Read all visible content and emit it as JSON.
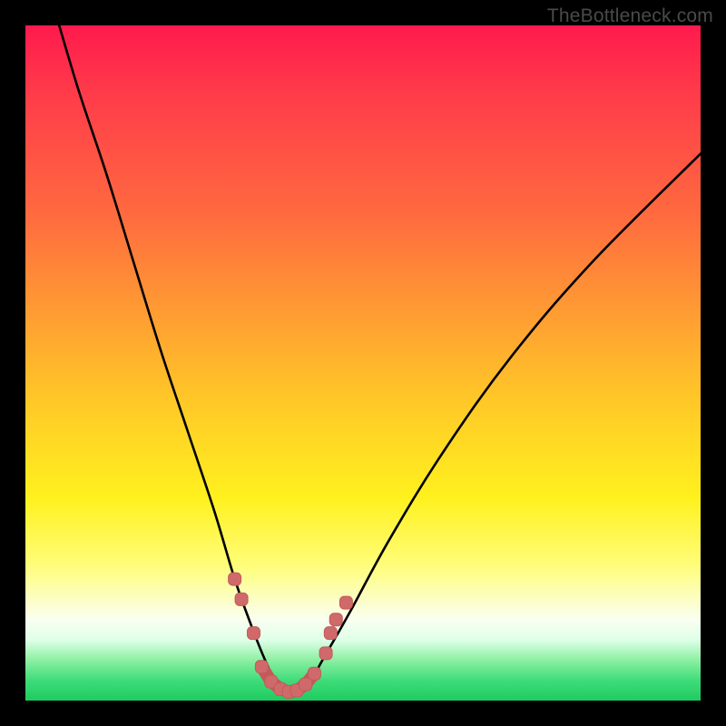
{
  "attribution": "TheBottleneck.com",
  "colors": {
    "page_bg": "#000000",
    "gradient_top": "#ff1a4d",
    "gradient_mid": "#fff11e",
    "gradient_bottom": "#1ecb60",
    "curve_stroke": "#000000",
    "marker_stroke": "#c25a5a",
    "marker_fill": "#d06a6a"
  },
  "chart_data": {
    "type": "line",
    "title": "",
    "xlabel": "",
    "ylabel": "",
    "xlim": [
      0,
      100
    ],
    "ylim": [
      0,
      100
    ],
    "grid": false,
    "legend": false,
    "series": [
      {
        "name": "curve",
        "x": [
          5,
          8,
          12,
          16,
          20,
          24,
          28,
          31,
          33.5,
          35.5,
          37,
          38.5,
          40,
          42,
          44,
          48,
          54,
          62,
          72,
          84,
          100
        ],
        "values": [
          100,
          90,
          78,
          65,
          52,
          40,
          28,
          18,
          11,
          6,
          3,
          1.6,
          1.2,
          2.5,
          6,
          13,
          24,
          37,
          51,
          65,
          81
        ]
      }
    ],
    "markers": [
      {
        "x": 31.0,
        "y": 18.0
      },
      {
        "x": 32.0,
        "y": 15.0
      },
      {
        "x": 33.8,
        "y": 10.0
      },
      {
        "x": 35.0,
        "y": 5.0
      },
      {
        "x": 36.4,
        "y": 2.8
      },
      {
        "x": 37.8,
        "y": 1.7
      },
      {
        "x": 39.0,
        "y": 1.3
      },
      {
        "x": 40.2,
        "y": 1.5
      },
      {
        "x": 41.5,
        "y": 2.4
      },
      {
        "x": 42.8,
        "y": 4.0
      },
      {
        "x": 44.5,
        "y": 7.0
      },
      {
        "x": 45.2,
        "y": 10.0
      },
      {
        "x": 46.0,
        "y": 12.0
      },
      {
        "x": 47.5,
        "y": 14.5
      }
    ]
  }
}
